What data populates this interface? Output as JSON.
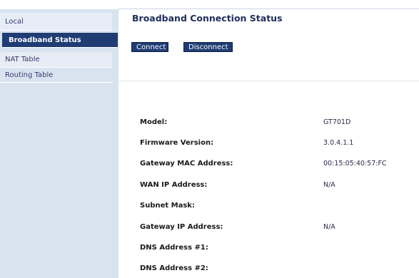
{
  "sidebar": {
    "items": [
      {
        "label": "Local"
      },
      {
        "label": "Broadband Status"
      },
      {
        "label": "NAT Table"
      },
      {
        "label": "Routing Table"
      }
    ]
  },
  "main": {
    "title": "Broadband Connection Status",
    "buttons": {
      "connect": "Connect",
      "disconnect": "Disconnect"
    },
    "rows": [
      {
        "label": "Model:",
        "value": "GT701D"
      },
      {
        "label": "Firmware Version:",
        "value": "3.0.4.1.1"
      },
      {
        "label": "Gateway MAC Address:",
        "value": "00:15:05:40:57:FC"
      },
      {
        "label": "WAN IP Address:",
        "value": "N/A"
      },
      {
        "label": "Subnet Mask:",
        "value": ""
      },
      {
        "label": "Gateway IP Address:",
        "value": "N/A"
      },
      {
        "label": "DNS Address #1:",
        "value": ""
      },
      {
        "label": "DNS Address #2:",
        "value": ""
      }
    ]
  },
  "colors": {
    "sidebar_bg": "#d9e3f0",
    "active_item_bg": "#1f3c73",
    "button_bg": "#1f3c73",
    "title_color": "#1f2e5a"
  }
}
